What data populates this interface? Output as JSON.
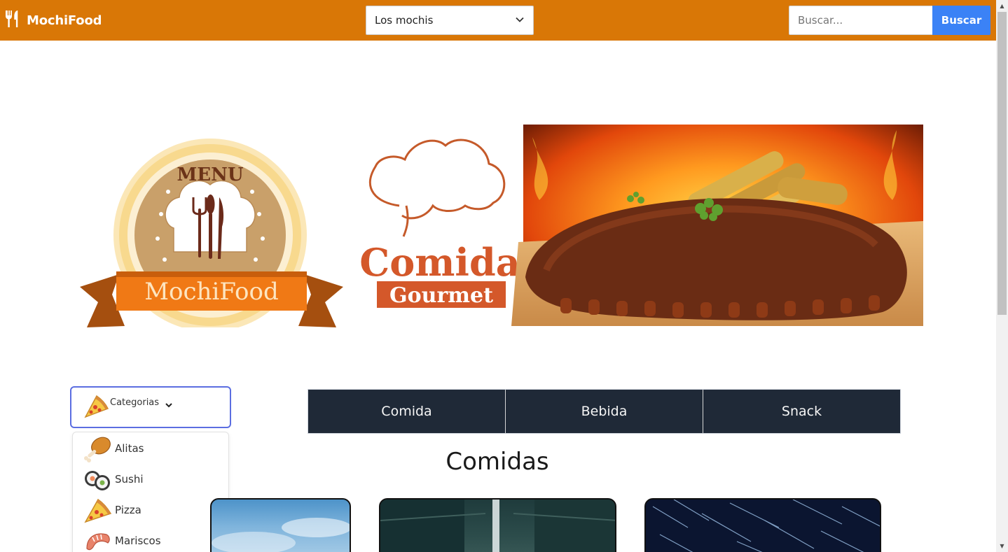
{
  "navbar": {
    "brand": "MochiFood",
    "city_selected": "Los mochis",
    "search_placeholder": "Buscar...",
    "search_button": "Buscar",
    "color": "#d97706",
    "button_color": "#3b82f6"
  },
  "banner": {
    "badge_top_text": "MENU",
    "badge_ribbon_text": "MochiFood",
    "logo_title": "Comida",
    "logo_subtitle": "Gourmet"
  },
  "categories": {
    "toggle_label": "Categorias",
    "items": [
      {
        "label": "Alitas",
        "icon": "chicken-leg-icon"
      },
      {
        "label": "Sushi",
        "icon": "sushi-icon"
      },
      {
        "label": "Pizza",
        "icon": "pizza-icon"
      },
      {
        "label": "Mariscos",
        "icon": "shrimp-icon"
      }
    ]
  },
  "tabs": [
    {
      "label": "Comida"
    },
    {
      "label": "Bebida"
    },
    {
      "label": "Snack"
    }
  ],
  "section_title": "Comidas"
}
